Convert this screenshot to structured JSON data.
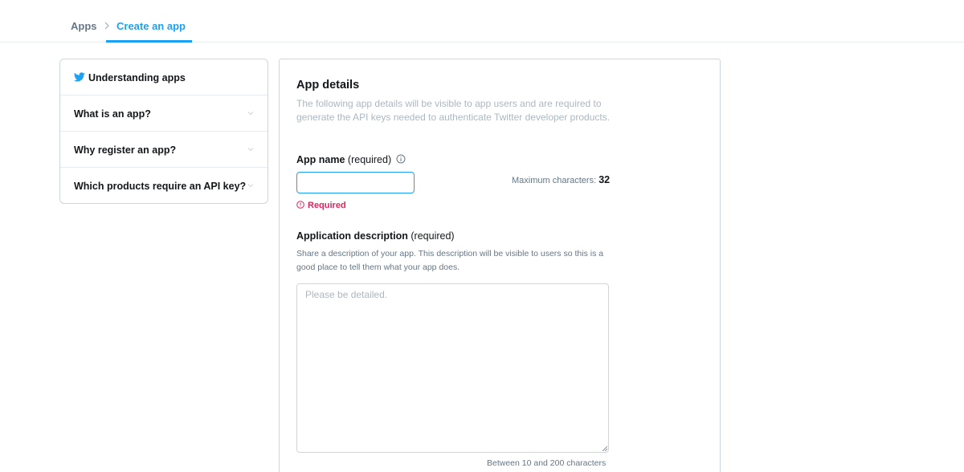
{
  "breadcrumb": {
    "apps": "Apps",
    "create": "Create an app"
  },
  "sidebar": {
    "items": [
      {
        "label": "Understanding apps",
        "icon": "twitter-bird-icon"
      },
      {
        "label": "What is an app?"
      },
      {
        "label": "Why register an app?"
      },
      {
        "label": "Which products require an API key?"
      }
    ]
  },
  "app_details": {
    "title": "App details",
    "description": "The following app details will be visible to app users and are required to generate the API keys needed to authenticate Twitter developer products."
  },
  "app_name": {
    "label": "App name",
    "required_note": "(required)",
    "value": "",
    "max_label": "Maximum characters:",
    "max_value": "32",
    "error": "Required"
  },
  "app_description": {
    "label": "Application description",
    "required_note": "(required)",
    "help": "Share a description of your app. This description will be visible to users so this is a good place to tell them what your app does.",
    "placeholder": "Please be detailed.",
    "limit": "Between 10 and 200 characters"
  },
  "colors": {
    "accent": "#1da1f2",
    "error": "#e0245e",
    "muted": "#657786"
  }
}
